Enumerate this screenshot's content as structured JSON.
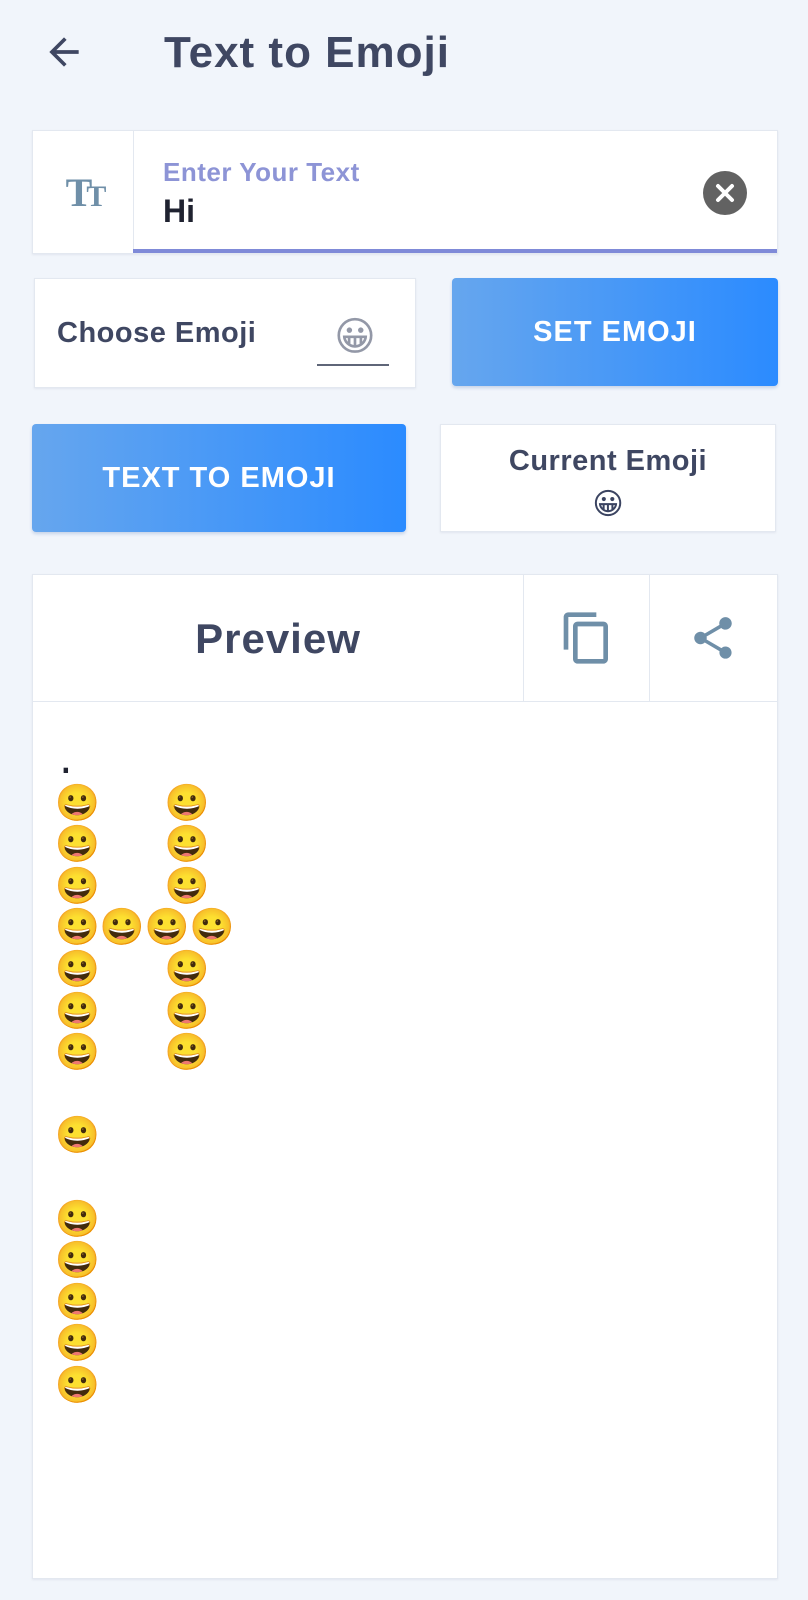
{
  "appbar": {
    "title": "Text to Emoji",
    "back_icon": "arrow-left-icon"
  },
  "input": {
    "label": "Enter Your Text",
    "value": "Hi",
    "leading_icon": "text-size-icon",
    "leading_icon_text": "T",
    "leading_icon_small": "T",
    "clear_icon": "close-circle-icon"
  },
  "choose": {
    "label": "Choose Emoji",
    "emoji": "😀"
  },
  "buttons": {
    "set_emoji": "SET EMOJI",
    "text_to_emoji": "TEXT TO EMOJI"
  },
  "current": {
    "label": "Current Emoji",
    "emoji": "😀"
  },
  "preview": {
    "title": "Preview",
    "copy_icon": "copy-icon",
    "share_icon": "share-icon",
    "text": ".\n😀   😀\n😀   😀\n😀   😀\n😀😀😀😀\n😀   😀\n😀   😀\n😀   😀\n\n😀\n\n😀\n😀\n😀\n😀\n😀"
  },
  "colors": {
    "background": "#f1f5fb",
    "accent_label": "#8d94d6",
    "button_gradient_start": "#66a6ee",
    "button_gradient_end": "#2b8bff",
    "icon_blue": "#6f8fa8",
    "text_dark": "#3f4762"
  }
}
